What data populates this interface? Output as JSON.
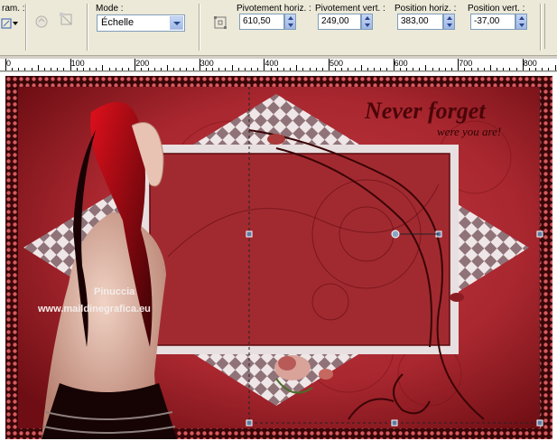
{
  "toolbar": {
    "preset_label": "ram. :",
    "mode_label": "Mode :",
    "mode_value": "Échelle",
    "pivot_h_label": "Pivotement horiz. :",
    "pivot_h_value": "610,50",
    "pivot_v_label": "Pivotement vert. :",
    "pivot_v_value": "249,00",
    "pos_h_label": "Position horiz. :",
    "pos_h_value": "383,00",
    "pos_v_label": "Position vert. :",
    "pos_v_value": "-37,00"
  },
  "ruler": {
    "labels": [
      "0",
      "100",
      "200",
      "300",
      "400",
      "500",
      "600",
      "700",
      "800"
    ]
  },
  "artwork": {
    "title_text": "Never forget",
    "subtitle_text": "were you are!",
    "watermark_line1": "Pinuccia",
    "watermark_line2": "www.maildinegrafica.eu",
    "colors": {
      "background": "#a9272f",
      "dark_red": "#6e0e14",
      "frame_light": "#e8dfe0",
      "check_dark": "#8f7378"
    }
  }
}
